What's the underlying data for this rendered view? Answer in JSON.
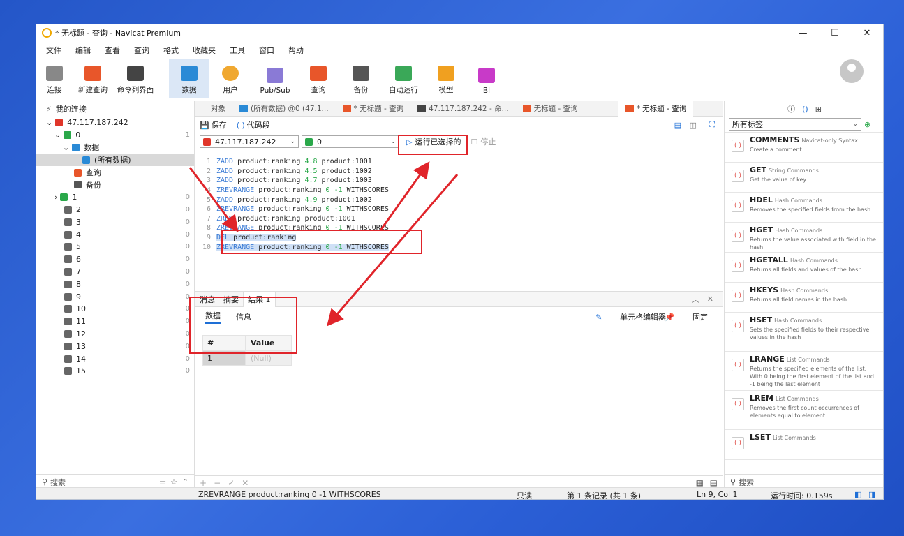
{
  "window": {
    "title": "* 无标题 - 查询 - Navicat Premium",
    "min": "—",
    "max": "☐",
    "close": "✕"
  },
  "menu": [
    "文件",
    "编辑",
    "查看",
    "查询",
    "格式",
    "收藏夹",
    "工具",
    "窗口",
    "帮助"
  ],
  "toolbar": [
    {
      "label": "连接",
      "icon": "plug-icon"
    },
    {
      "label": "新建查询",
      "icon": "new-query-icon"
    },
    {
      "label": "命令列界面",
      "icon": "console-icon"
    },
    {
      "label": "数据",
      "icon": "table-icon"
    },
    {
      "label": "用户",
      "icon": "user-icon"
    },
    {
      "label": "Pub/Sub",
      "icon": "broadcast-icon"
    },
    {
      "label": "查询",
      "icon": "query-icon"
    },
    {
      "label": "备份",
      "icon": "backup-icon"
    },
    {
      "label": "自动运行",
      "icon": "robot-icon"
    },
    {
      "label": "模型",
      "icon": "model-icon"
    },
    {
      "label": "BI",
      "icon": "bi-icon"
    }
  ],
  "sidebar": {
    "header": "我的连接",
    "connection": "47.117.187.242",
    "db0": "0",
    "db0_count": "1",
    "data_node": "数据",
    "all_data": "(所有数据)",
    "query": "查询",
    "backup": "备份",
    "dbs": [
      {
        "name": "1",
        "count": "0"
      },
      {
        "name": "2",
        "count": "0"
      },
      {
        "name": "3",
        "count": "0"
      },
      {
        "name": "4",
        "count": "0"
      },
      {
        "name": "5",
        "count": "0"
      },
      {
        "name": "6",
        "count": "0"
      },
      {
        "name": "7",
        "count": "0"
      },
      {
        "name": "8",
        "count": "0"
      },
      {
        "name": "9",
        "count": "0"
      },
      {
        "name": "10",
        "count": "0"
      },
      {
        "name": "11",
        "count": "0"
      },
      {
        "name": "12",
        "count": "0"
      },
      {
        "name": "13",
        "count": "0"
      },
      {
        "name": "14",
        "count": "0"
      },
      {
        "name": "15",
        "count": "0"
      }
    ],
    "search": "搜索"
  },
  "tabs": [
    "对象",
    "(所有数据) @0 (47.1...",
    "* 无标题 - 查询",
    "47.117.187.242 - 命...",
    "无标题 - 查询",
    "* 无标题 - 查询"
  ],
  "query_toolbar": {
    "save": "保存",
    "snippet": "代码段",
    "run_selected": "运行已选择的",
    "stop": "停止",
    "connection": "47.117.187.242",
    "db": "0"
  },
  "editor": [
    {
      "n": "1",
      "kw": "ZADD",
      "rest": " product:ranking ",
      "v": "4.8",
      "tail": " product:1001"
    },
    {
      "n": "2",
      "kw": "ZADD",
      "rest": " product:ranking ",
      "v": "4.5",
      "tail": " product:1002"
    },
    {
      "n": "3",
      "kw": "ZADD",
      "rest": " product:ranking ",
      "v": "4.7",
      "tail": " product:1003"
    },
    {
      "n": "4",
      "kw": "ZREVRANGE",
      "rest": " product:ranking ",
      "v": "0 -1",
      "tail": " WITHSCORES"
    },
    {
      "n": "5",
      "kw": "ZADD",
      "rest": " product:ranking ",
      "v": "4.9",
      "tail": " product:1002"
    },
    {
      "n": "6",
      "kw": "ZREVRANGE",
      "rest": " product:ranking ",
      "v": "0 -1",
      "tail": " WITHSCORES"
    },
    {
      "n": "7",
      "kw": "ZREM",
      "rest": " product:ranking product:1001",
      "v": "",
      "tail": ""
    },
    {
      "n": "8",
      "kw": "ZREVRANGE",
      "rest": " product:ranking ",
      "v": "0 -1",
      "tail": " WITHSCORES"
    },
    {
      "n": "9",
      "kw": "DEL",
      "rest": " product:ranking",
      "v": "",
      "tail": ""
    },
    {
      "n": "10",
      "kw": "ZREVRANGE",
      "rest": " product:ranking ",
      "v": "0 -1",
      "tail": " WITHSCORES"
    }
  ],
  "results": {
    "tabs": [
      "消息",
      "摘要",
      "结果 1"
    ],
    "subtabs": [
      "数据",
      "信息"
    ],
    "cell_editor": "单元格编辑器",
    "pin": "固定",
    "col_hash": "#",
    "col_value": "Value",
    "row_num": "1",
    "row_value": "(Null)"
  },
  "snippets": {
    "filter": "所有标签",
    "search": "搜索",
    "items": [
      {
        "name": "COMMENTS",
        "cat": "Navicat-only Syntax",
        "desc": "Create a comment"
      },
      {
        "name": "GET",
        "cat": "String Commands",
        "desc": "Get the value of key"
      },
      {
        "name": "HDEL",
        "cat": "Hash Commands",
        "desc": "Removes the specified fields from the hash"
      },
      {
        "name": "HGET",
        "cat": "Hash Commands",
        "desc": "Returns the value associated with field in the hash"
      },
      {
        "name": "HGETALL",
        "cat": "Hash Commands",
        "desc": "Returns all fields and values of the hash"
      },
      {
        "name": "HKEYS",
        "cat": "Hash Commands",
        "desc": "Returns all field names in the hash"
      },
      {
        "name": "HSET",
        "cat": "Hash Commands",
        "desc": "Sets the specified fields to their respective values in the hash"
      },
      {
        "name": "LRANGE",
        "cat": "List Commands",
        "desc": "Returns the specified elements of the list. With 0 being the first element of the list and -1 being the last element"
      },
      {
        "name": "LREM",
        "cat": "List Commands",
        "desc": "Removes the first count occurrences of elements equal to element"
      },
      {
        "name": "LSET",
        "cat": "List Commands",
        "desc": ""
      }
    ]
  },
  "status": {
    "sql": "ZREVRANGE product:ranking 0 -1 WITHSCORES",
    "readonly": "只读",
    "records": "第 1 条记录 (共 1 条)",
    "pos": "Ln 9, Col 1",
    "time": "运行时间: 0.159s"
  },
  "colors": {
    "accent": "#1e6fd6",
    "annotation": "#e0242a",
    "selection": "#cfe0f6"
  }
}
